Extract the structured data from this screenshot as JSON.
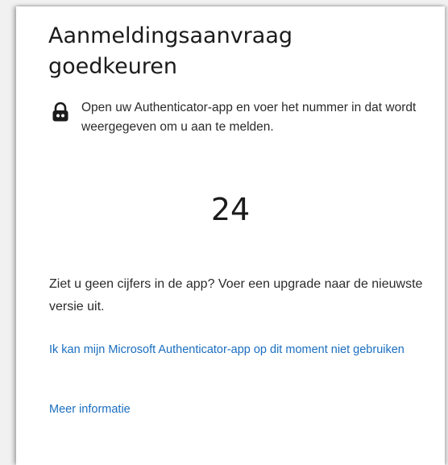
{
  "dialog": {
    "title": "Aanmeldingsaanvraag goedkeuren",
    "info_icon": "lock-icon",
    "instruction": "Open uw Authenticator-app en voer het nummer in dat wordt weergegeven om u aan te melden.",
    "number": "24",
    "upgrade_note": "Ziet u geen cijfers in de app? Voer een upgrade naar de nieuwste versie uit.",
    "link_cannot_use": "Ik kan mijn Microsoft Authenticator-app op dit moment niet gebruiken",
    "link_more_info": "Meer informatie"
  },
  "colors": {
    "link": "#1a6ec0",
    "text": "#1b1b1b",
    "background": "#ffffff"
  }
}
